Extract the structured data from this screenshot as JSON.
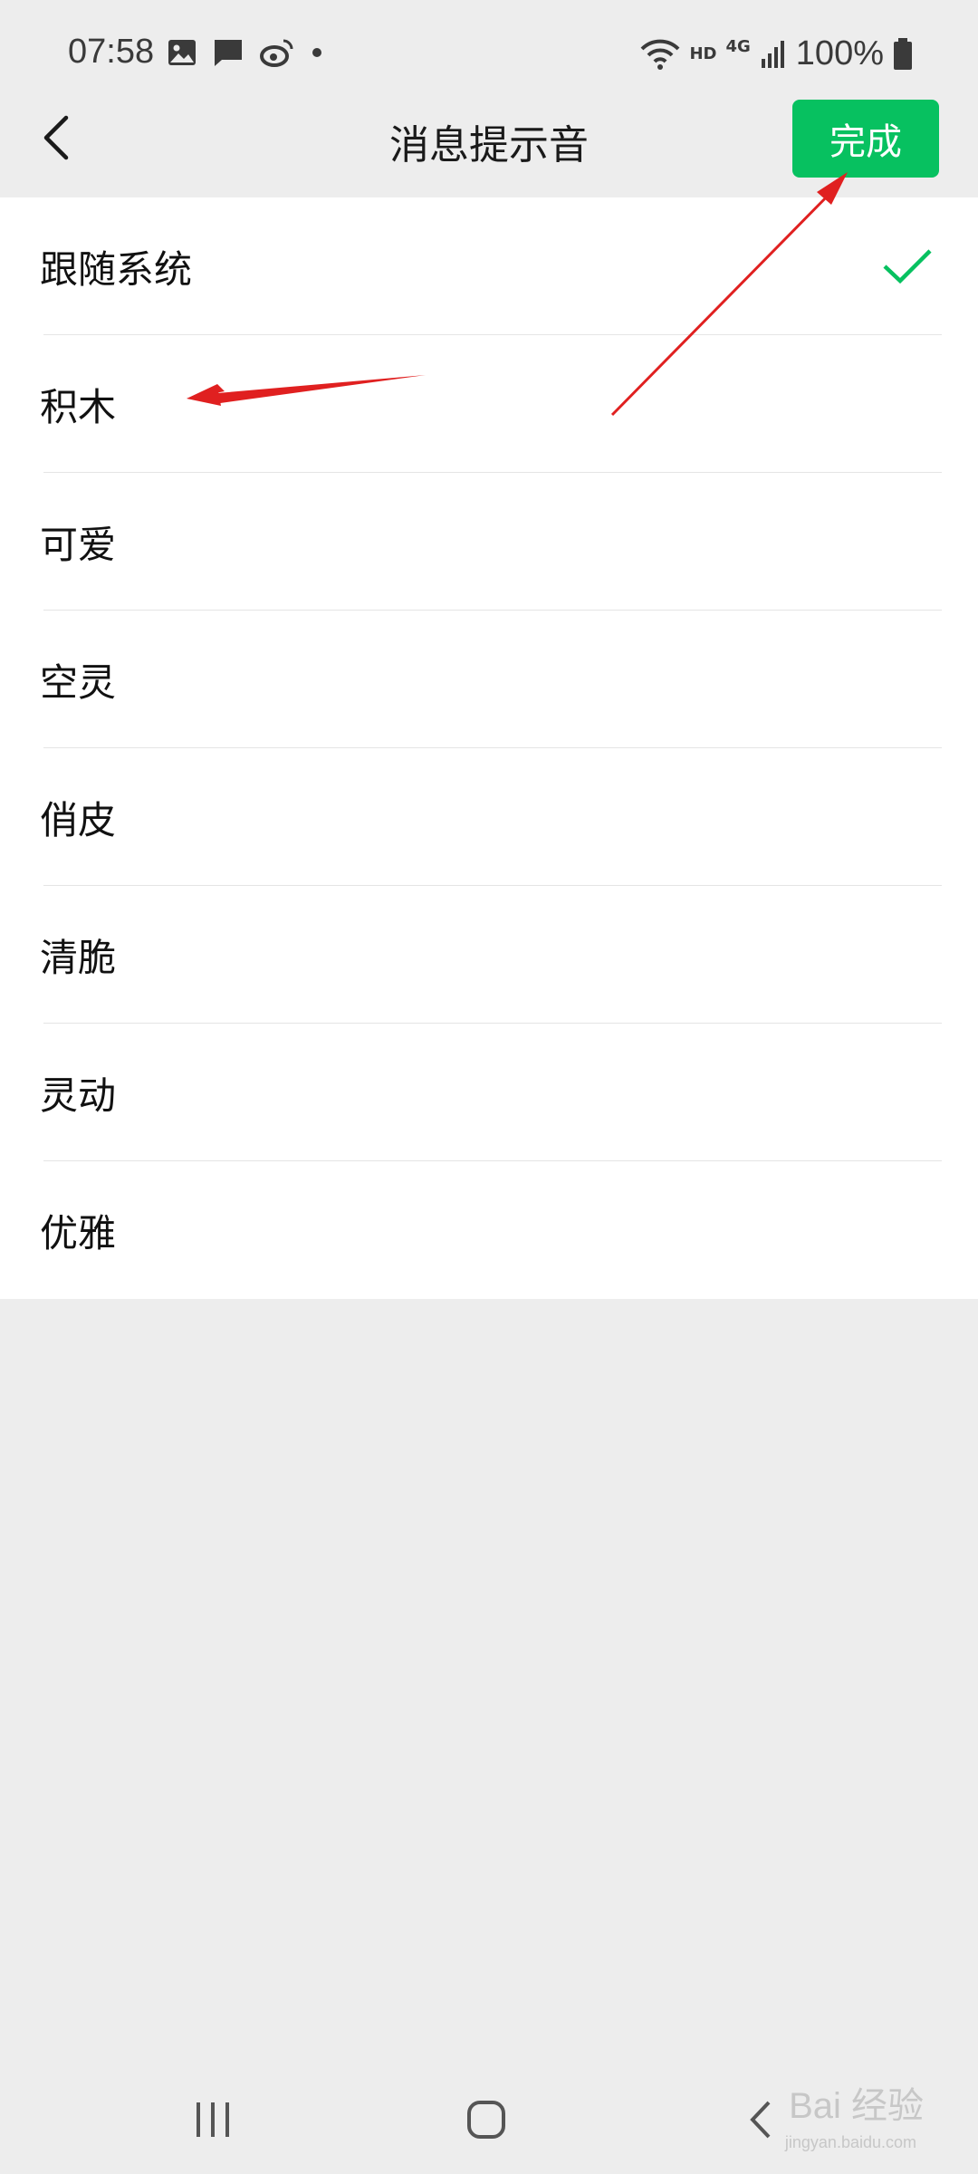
{
  "status_bar": {
    "time": "07:58",
    "battery_text": "100%",
    "network_text": "HD",
    "signal_text": "4G",
    "icons_left": [
      "image-icon",
      "message-icon",
      "weibo-icon",
      "dot-icon"
    ],
    "icons_right": [
      "wifi-icon",
      "signal-icon",
      "battery-icon"
    ]
  },
  "nav": {
    "title": "消息提示音",
    "done_label": "完成"
  },
  "sounds": [
    {
      "label": "跟随系统",
      "selected": true
    },
    {
      "label": "积木",
      "selected": false
    },
    {
      "label": "可爱",
      "selected": false
    },
    {
      "label": "空灵",
      "selected": false
    },
    {
      "label": "俏皮",
      "selected": false
    },
    {
      "label": "清脆",
      "selected": false
    },
    {
      "label": "灵动",
      "selected": false
    },
    {
      "label": "优雅",
      "selected": false
    }
  ],
  "colors": {
    "accent": "#07c160",
    "annotation": "#e02020",
    "background": "#ededed"
  },
  "watermark": {
    "text": "Bai 经验",
    "sub": "jingyan.baidu.com"
  }
}
